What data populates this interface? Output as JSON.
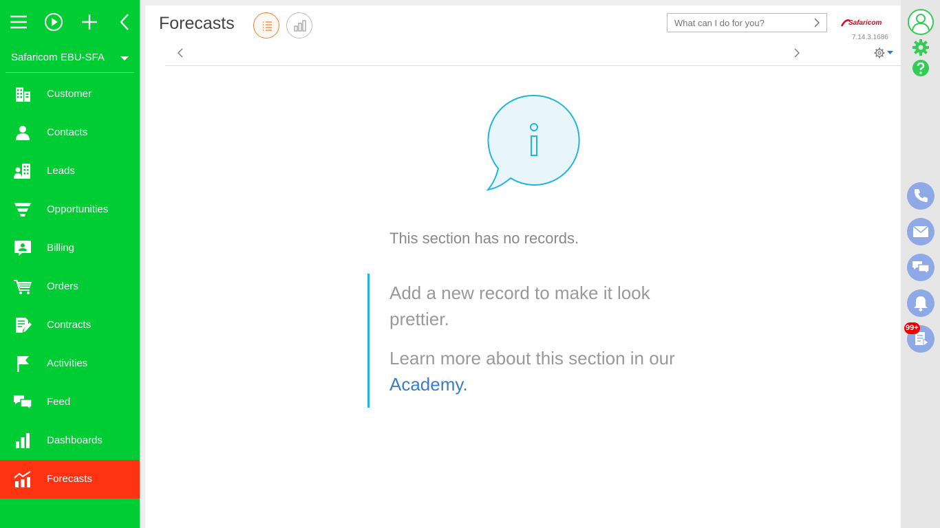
{
  "sidebar": {
    "org_name": "Safaricom EBU-SFA",
    "items": [
      {
        "label": "Customer",
        "icon": "building-icon"
      },
      {
        "label": "Contacts",
        "icon": "person-icon"
      },
      {
        "label": "Leads",
        "icon": "leads-icon"
      },
      {
        "label": "Opportunities",
        "icon": "funnel-icon"
      },
      {
        "label": "Billing",
        "icon": "billing-icon"
      },
      {
        "label": "Orders",
        "icon": "cart-icon"
      },
      {
        "label": "Contracts",
        "icon": "contract-icon"
      },
      {
        "label": "Activities",
        "icon": "flag-icon"
      },
      {
        "label": "Feed",
        "icon": "chat-icon"
      },
      {
        "label": "Dashboards",
        "icon": "bar-chart-icon"
      },
      {
        "label": "Forecasts",
        "icon": "forecast-icon",
        "active": true
      }
    ],
    "colors": {
      "background": "#00cc33",
      "active": "#ff3311"
    }
  },
  "header": {
    "title": "Forecasts",
    "search_placeholder": "What can I do for you?",
    "logo_text": "Safaricom",
    "version": "7.14.3.1686"
  },
  "empty_state": {
    "message": "This section has no records.",
    "hint_line": "Add a new record to make it look prettier.",
    "learn_prefix": "Learn more about this section in our ",
    "academy_link": "Academy."
  },
  "rail": {
    "notification_badge": "99+"
  }
}
